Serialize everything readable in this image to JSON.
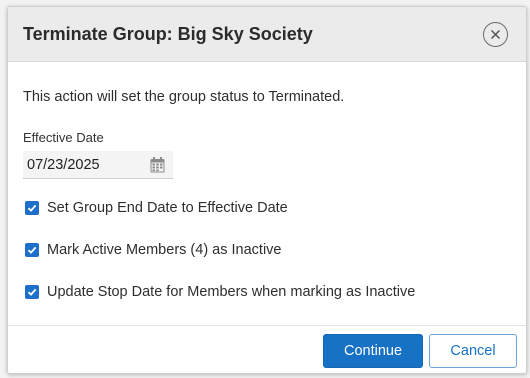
{
  "dialog": {
    "title": "Terminate Group: Big Sky Society",
    "description": "This action will set the group status to Terminated.",
    "close_icon": "close-icon"
  },
  "effective_date": {
    "label": "Effective Date",
    "value": "07/23/2025",
    "icon": "calendar-icon"
  },
  "options": [
    {
      "label": "Set Group End Date to Effective Date",
      "checked": true
    },
    {
      "label": "Mark Active Members (4) as Inactive",
      "checked": true
    },
    {
      "label": "Update Stop Date for Members when marking as Inactive",
      "checked": true
    }
  ],
  "footer": {
    "continue_label": "Continue",
    "cancel_label": "Cancel"
  },
  "colors": {
    "primary": "#1771c4",
    "header_bg": "#ebebeb"
  }
}
